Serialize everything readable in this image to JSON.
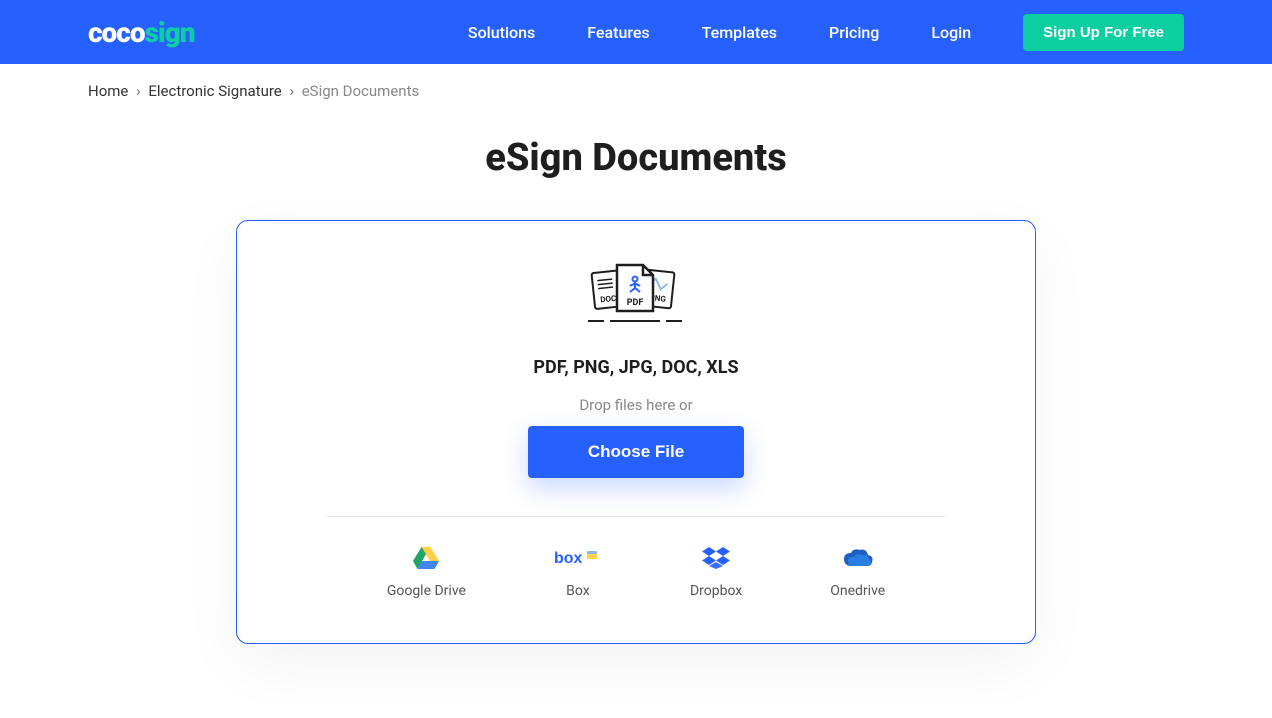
{
  "logo": {
    "part1": "coco",
    "part2": "sign"
  },
  "nav": {
    "solutions": "Solutions",
    "features": "Features",
    "templates": "Templates",
    "pricing": "Pricing",
    "login": "Login",
    "signup": "Sign Up For Free"
  },
  "breadcrumb": {
    "home": "Home",
    "esig": "Electronic Signature",
    "current": "eSign Documents"
  },
  "page": {
    "title": "eSign Documents",
    "formats": "PDF, PNG, JPG, DOC, XLS",
    "drop_text": "Drop files here or",
    "choose_file": "Choose File"
  },
  "providers": {
    "gdrive": "Google Drive",
    "box": "Box",
    "dropbox": "Dropbox",
    "onedrive": "Onedrive"
  }
}
